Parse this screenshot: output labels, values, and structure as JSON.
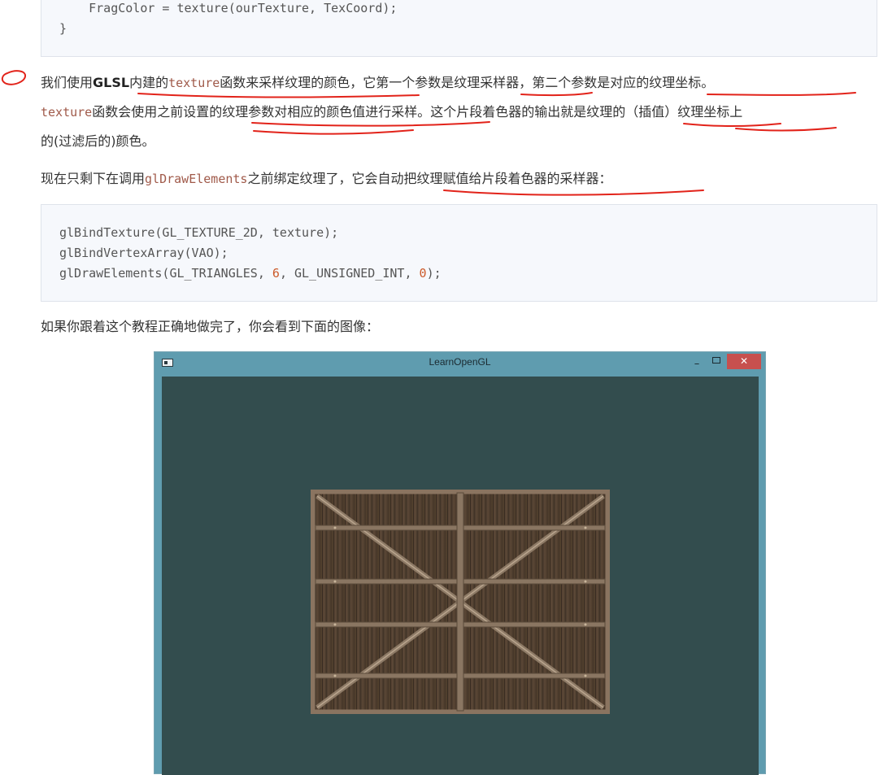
{
  "code_top": {
    "line1": "    FragColor = texture(ourTexture, TexCoord);",
    "line2": "}"
  },
  "paragraph1": {
    "p1a": "我们使用",
    "p1b": "GLSL",
    "p1c": "内建的",
    "p1d": "texture",
    "p1e": "函数来采样纹理的颜色，它第一个参数是纹理采样器，第二个参数是对应的纹理坐标。",
    "p2a": "texture",
    "p2b": "函数会使用之前设置的纹理参数对相应的颜色值进行采样。这个片段着色器的输出就是纹理的（插值）纹理坐标上",
    "p3": "的(过滤后的)颜色。"
  },
  "paragraph2": {
    "a": "现在只剩下在调用",
    "b": "glDrawElements",
    "c": "之前绑定纹理了，它会自动把纹理赋值给片段着色器的采样器："
  },
  "code_bottom": {
    "line1": "glBindTexture(GL_TEXTURE_2D, texture);",
    "line2": "glBindVertexArray(VAO);",
    "line3a": "glDrawElements(GL_TRIANGLES, ",
    "line3num1": "6",
    "line3b": ", GL_UNSIGNED_INT, ",
    "line3num2": "0",
    "line3c": ");"
  },
  "paragraph3": "如果你跟着这个教程正确地做完了，你会看到下面的图像：",
  "window": {
    "title": "LearnOpenGL",
    "minimize": "–",
    "close": "✕",
    "background_color": "#334d4e",
    "titlebar_color": "#5f9caf"
  },
  "annotation_color": "#e2231a"
}
